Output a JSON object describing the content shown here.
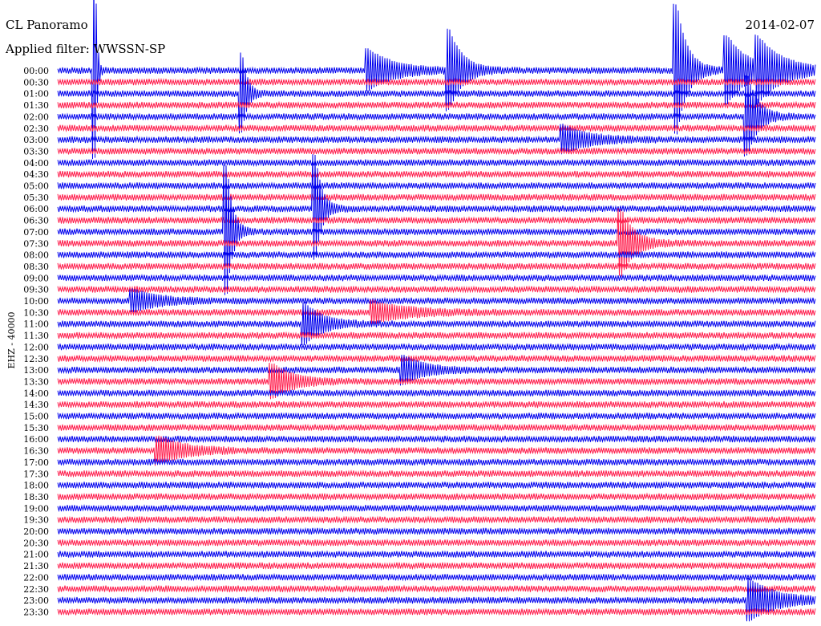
{
  "station_title": "CL Panoramo",
  "filter_line": "Applied filter: WWSSN-SP",
  "date": "2014-02-07",
  "axis_label": "EHZ - 40000",
  "colors": {
    "odd_trace": "#0000ee",
    "even_trace": "#ff1a4a",
    "background": "#ffffff"
  },
  "chart_data": {
    "type": "line",
    "title": "CL Panoramo",
    "subtitle": "Applied filter: WWSSN-SP",
    "xlabel": "",
    "ylabel": "EHZ - 40000",
    "grid": false,
    "legend": "none",
    "x_unit_minutes_per_row": 30,
    "row_labels": [
      "00:00",
      "00:30",
      "01:00",
      "01:30",
      "02:00",
      "02:30",
      "03:00",
      "03:30",
      "04:00",
      "04:30",
      "05:00",
      "05:30",
      "06:00",
      "06:30",
      "07:00",
      "07:30",
      "08:00",
      "08:30",
      "09:00",
      "09:30",
      "10:00",
      "10:30",
      "11:00",
      "11:30",
      "12:00",
      "12:30",
      "13:00",
      "13:30",
      "14:00",
      "14:30",
      "15:00",
      "15:30",
      "16:00",
      "16:30",
      "17:00",
      "17:30",
      "18:00",
      "18:30",
      "19:00",
      "19:30",
      "20:00",
      "20:30",
      "21:00",
      "21:30",
      "22:00",
      "22:30",
      "23:00",
      "23:30"
    ],
    "events": [
      {
        "row": 0,
        "minute": 1.5,
        "amplitude": 14,
        "decay": 60
      },
      {
        "row": 0,
        "minute": 15.5,
        "amplitude": 6,
        "decay": 8
      },
      {
        "row": 0,
        "minute": 27.7,
        "amplitude": 4,
        "decay": 4
      },
      {
        "row": 0,
        "minute": 12.3,
        "amplitude": 3,
        "decay": 4
      },
      {
        "row": 0,
        "minute": 24.5,
        "amplitude": 10,
        "decay": 10
      },
      {
        "row": 0,
        "minute": 26.5,
        "amplitude": 5,
        "decay": 5
      },
      {
        "row": 2,
        "minute": 7.3,
        "amplitude": 6,
        "decay": 20
      },
      {
        "row": 4,
        "minute": 27.3,
        "amplitude": 6,
        "decay": 10
      },
      {
        "row": 6,
        "minute": 20.0,
        "amplitude": 2,
        "decay": 4
      },
      {
        "row": 12,
        "minute": 10.2,
        "amplitude": 8,
        "decay": 16
      },
      {
        "row": 14,
        "minute": 6.7,
        "amplitude": 10,
        "decay": 18
      },
      {
        "row": 15,
        "minute": 22.3,
        "amplitude": 5,
        "decay": 8
      },
      {
        "row": 20,
        "minute": 3.0,
        "amplitude": 1.5,
        "decay": 4
      },
      {
        "row": 21,
        "minute": 12.5,
        "amplitude": 1.5,
        "decay": 3
      },
      {
        "row": 22,
        "minute": 9.8,
        "amplitude": 3,
        "decay": 6
      },
      {
        "row": 26,
        "minute": 13.7,
        "amplitude": 2,
        "decay": 5
      },
      {
        "row": 27,
        "minute": 8.5,
        "amplitude": 2.5,
        "decay": 5
      },
      {
        "row": 33,
        "minute": 4.0,
        "amplitude": 2,
        "decay": 4
      },
      {
        "row": 46,
        "minute": 27.4,
        "amplitude": 3,
        "decay": 4
      }
    ]
  }
}
